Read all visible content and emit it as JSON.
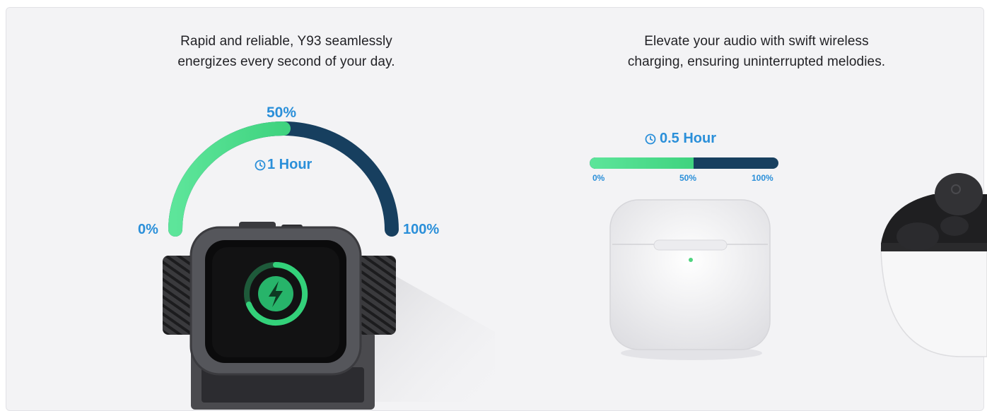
{
  "watch_section": {
    "headline_line1": "Rapid and reliable,  Y93 seamlessly",
    "headline_line2": "energizes every second of your day.",
    "gauge": {
      "progress": 0.5,
      "value_label": "50%",
      "time_label": "1 Hour",
      "min_label": "0%",
      "max_label": "100%"
    }
  },
  "earbuds_section": {
    "headline_line1": "Elevate your audio with swift wireless",
    "headline_line2": "charging, ensuring uninterrupted melodies.",
    "progress_bar": {
      "progress": 0.55,
      "time_label": "0.5 Hour",
      "tick_labels": [
        "0%",
        "50%",
        "100%"
      ]
    }
  },
  "colors": {
    "background": "#f3f3f5",
    "progress_fill": "#5de59a",
    "progress_track": "#173f5f",
    "label_accent": "#2a8fd9",
    "charge_icon": "#33d17a"
  },
  "icons": [
    "clock-icon",
    "lightning-bolt-icon"
  ]
}
